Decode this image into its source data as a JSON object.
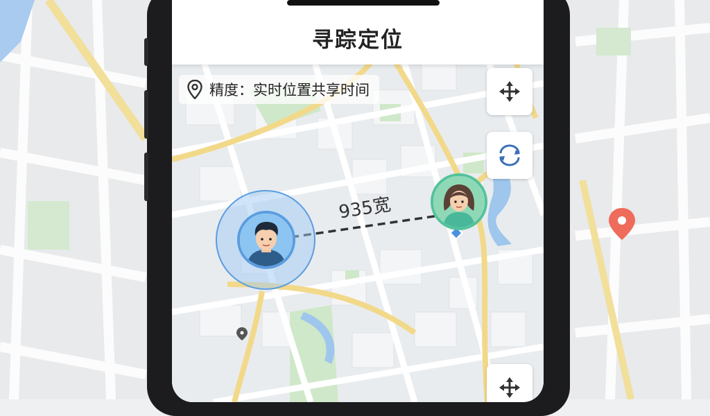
{
  "app": {
    "title": "寻踪定位"
  },
  "accuracy": {
    "icon": "location-pin-icon",
    "label": "精度：实时位置共享时间"
  },
  "distance": {
    "label": "935宽"
  },
  "controls": [
    {
      "name": "move-control",
      "icon": "move-arrows-icon"
    },
    {
      "name": "rotate-control",
      "icon": "rotate-icon"
    },
    {
      "name": "move-control-bottom",
      "icon": "move-arrows-icon"
    }
  ],
  "users": [
    {
      "name": "me",
      "icon": "male-avatar-icon",
      "ring_color": "#5a9de0"
    },
    {
      "name": "friend",
      "icon": "female-avatar-icon",
      "ring_color": "#52c39a"
    }
  ],
  "colors": {
    "header_bg": "#ffffff",
    "map_bg": "#e9ecef",
    "road_major": "#f2d98a",
    "park": "#cfe8c9",
    "water": "#9fc6ec",
    "poi": "#ef6b5b"
  }
}
